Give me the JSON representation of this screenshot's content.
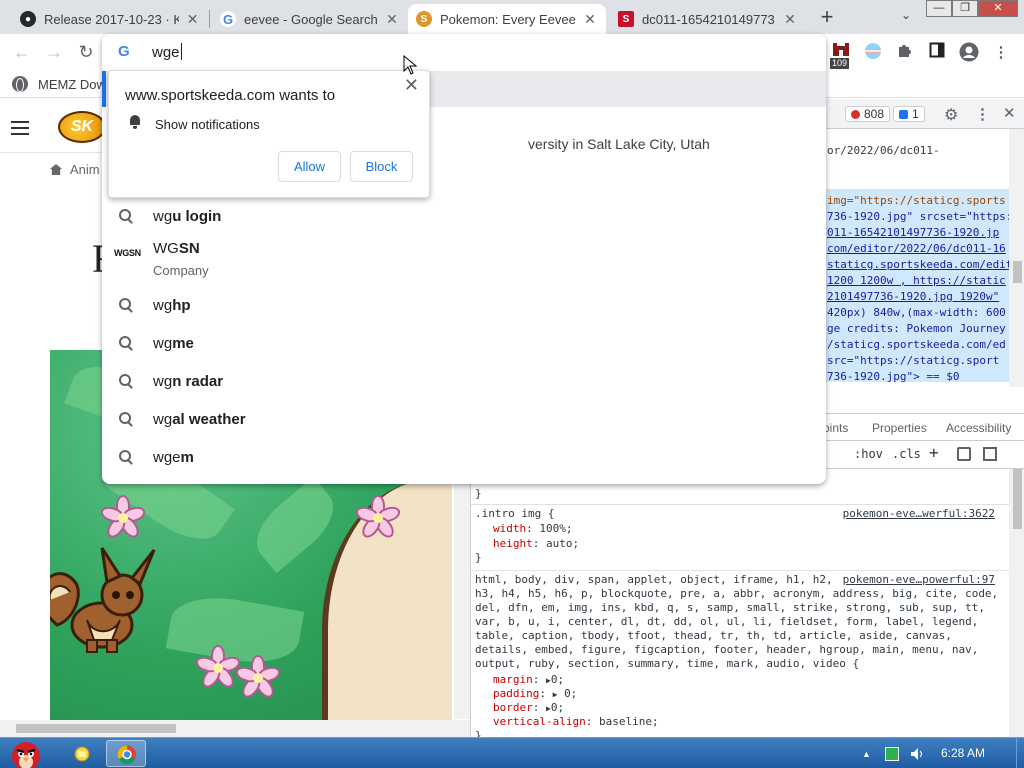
{
  "tabs": [
    {
      "title": "Release 2017-10-23 · Ka",
      "icon": "github-icon"
    },
    {
      "title": "eevee - Google Search",
      "icon": "google-icon"
    },
    {
      "title": "Pokemon: Every Eevee",
      "icon": "sportskeeda-icon"
    },
    {
      "title": "dc011-1654210149773",
      "icon": "sportskeeda-red-icon"
    }
  ],
  "omnibox": {
    "typed": "wge",
    "suggestions": [
      {
        "typed": "wg",
        "completion": "u login",
        "icon": "search-icon"
      },
      {
        "typed": "WG",
        "completion": "SN",
        "subtitle": "Company",
        "icon": "wgsn-logo"
      },
      {
        "typed": "wg",
        "completion": "hp",
        "icon": "search-icon"
      },
      {
        "typed": "wg",
        "completion": "me",
        "icon": "search-icon"
      },
      {
        "typed": "wg",
        "completion": "n radar",
        "icon": "search-icon"
      },
      {
        "typed": "wg",
        "completion": "al weather",
        "icon": "search-icon"
      },
      {
        "typed": "wge",
        "completion": "m",
        "icon": "search-icon"
      }
    ],
    "background_text": "versity in Salt Lake City, Utah",
    "wgsn_logo_text": "WGSN"
  },
  "notification": {
    "title": "www.sportskeeda.com wants to",
    "item": "Show notifications",
    "allow": "Allow",
    "block": "Block"
  },
  "toolbar": {
    "extension_badge": "109"
  },
  "bookmarks": [
    {
      "label": "MEMZ Dow"
    }
  ],
  "page": {
    "logo_text": "SK",
    "breadcrumb": "Anim",
    "headline_fragment": "F"
  },
  "devtools": {
    "errors": "808",
    "messages": "1",
    "element_lines": [
      {
        "text": "or/2022/06/dc011-"
      },
      {
        "text": "img=\"https://staticg.sports"
      },
      {
        "text": "736-1920.jpg\" srcset=\"https:"
      },
      {
        "text": "011-16542101497736-1920.jp"
      },
      {
        "text": "com/editor/2022/06/dc011-16"
      },
      {
        "text": "staticg.sportskeeda.com/edit"
      },
      {
        "text": "1200 1200w , https://static"
      },
      {
        "text": "2101497736-1920.jpg 1920w\""
      },
      {
        "text": "420px) 840w,(max-width: 600"
      },
      {
        "text": "ge credits: Pokemon Journey"
      },
      {
        "text": "/staticg.sportskeeda.com/ed"
      },
      {
        "text": " src=\"https://staticg.sport"
      },
      {
        "text": "736-1920.jpg\"> == $0"
      }
    ],
    "subtabs": [
      "oints",
      "Properties",
      "Accessibility"
    ],
    "filter": {
      "hov": ":hov",
      "cls": ".cls",
      "plus": "+"
    },
    "rules": {
      "closing_brace": "}",
      "intro_selector": ".intro img {",
      "intro_source": "pokemon-eve…werful:3622",
      "intro_props": [
        {
          "name": "width",
          "value": "100%;"
        },
        {
          "name": "height",
          "value": "auto;"
        }
      ],
      "intro_close": "}",
      "reset_source": "pokemon-eve…powerful:97",
      "reset_selectors": [
        "html, body, div, span, applet, object, iframe, h1, h2,",
        "h3, h4, h5, h6, p, blockquote, pre, a, abbr, acronym, address, big, cite, code,",
        "del, dfn, em, img, ins, kbd, q, s, samp, small, strike, strong, sub, sup, tt,",
        "var, b, u, i, center, dl, dt, dd, ol, ul, li, fieldset, form, label, legend,",
        "table, caption, tbody, tfoot, thead, tr, th, td, article, aside, canvas,",
        "details, embed, figure, figcaption, footer, header, hgroup, main, menu, nav,",
        "output, ruby, section, summary, time, mark, audio, video {"
      ],
      "reset_props": [
        {
          "name": "margin",
          "value": "0;"
        },
        {
          "name": "padding",
          "value": "0;"
        },
        {
          "name": "border",
          "value": "0;"
        },
        {
          "name": "vertical-align",
          "value": "baseline;"
        }
      ],
      "reset_close": "}"
    }
  },
  "taskbar": {
    "clock": "6:28 AM"
  },
  "colors": {
    "accent": "#1a73e8",
    "tab_strip": "#dee1e6",
    "error_red": "#d93025",
    "taskbar": "#245fa8"
  }
}
